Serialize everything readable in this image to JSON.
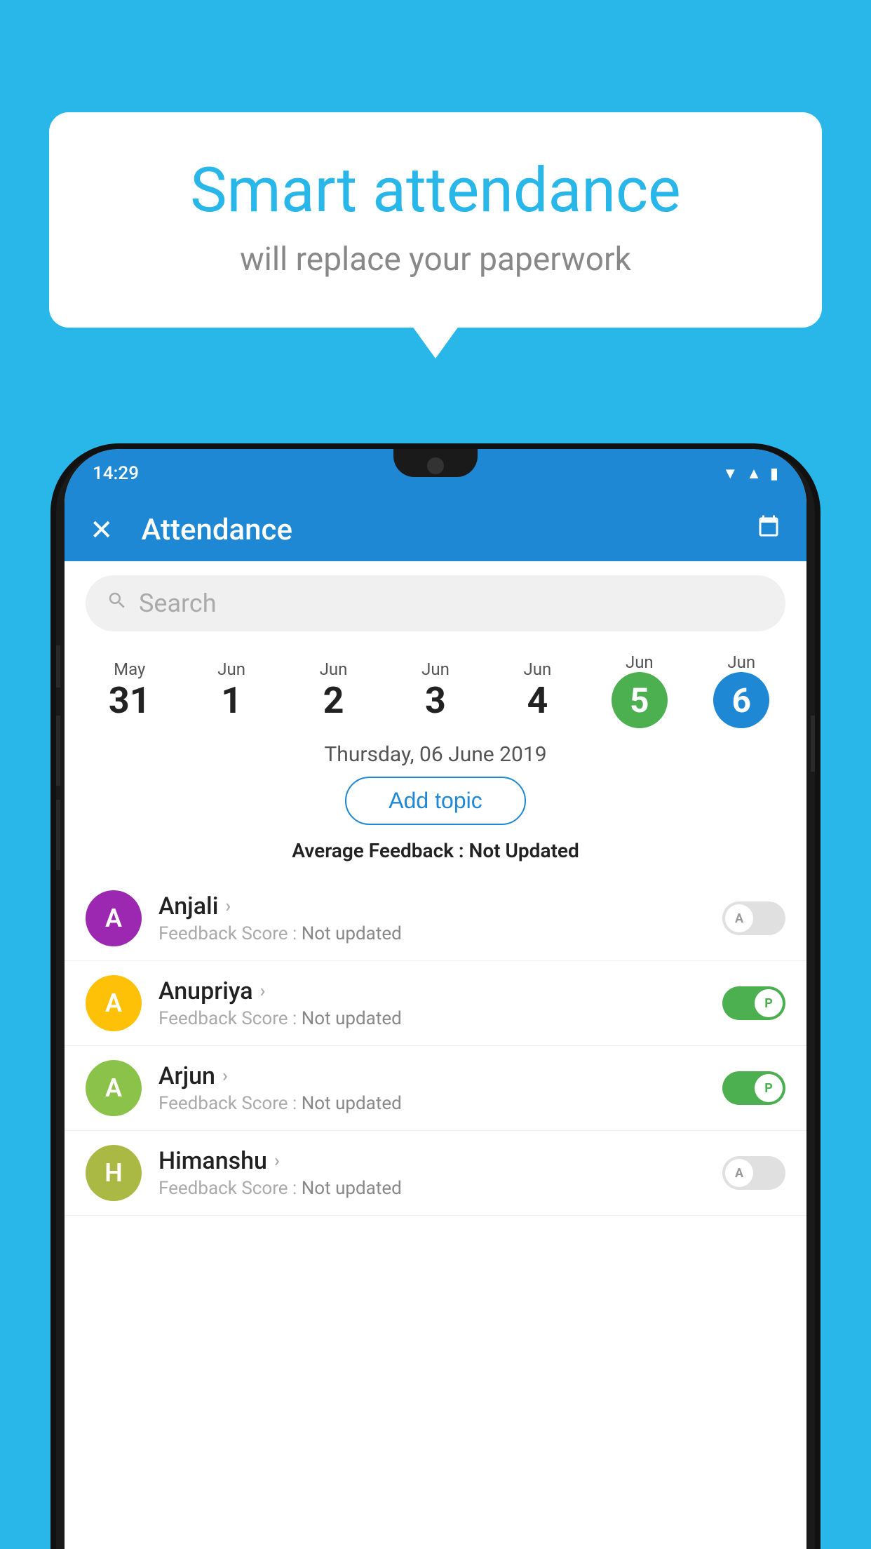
{
  "bubble": {
    "title": "Smart attendance",
    "subtitle": "will replace your paperwork"
  },
  "status_bar": {
    "time": "14:29",
    "icons": [
      "wifi",
      "signal",
      "battery"
    ]
  },
  "app_header": {
    "title": "Attendance",
    "close_label": "×",
    "calendar_icon": "📅"
  },
  "search": {
    "placeholder": "Search"
  },
  "calendar": {
    "days": [
      {
        "month": "May",
        "day": "31",
        "selected": ""
      },
      {
        "month": "Jun",
        "day": "1",
        "selected": ""
      },
      {
        "month": "Jun",
        "day": "2",
        "selected": ""
      },
      {
        "month": "Jun",
        "day": "3",
        "selected": ""
      },
      {
        "month": "Jun",
        "day": "4",
        "selected": ""
      },
      {
        "month": "Jun",
        "day": "5",
        "selected": "green"
      },
      {
        "month": "Jun",
        "day": "6",
        "selected": "blue"
      }
    ]
  },
  "date_header": "Thursday, 06 June 2019",
  "add_topic_label": "Add topic",
  "avg_feedback_label": "Average Feedback :",
  "avg_feedback_value": "Not Updated",
  "students": [
    {
      "name": "Anjali",
      "avatar_letter": "A",
      "avatar_color": "#9c27b0",
      "feedback_label": "Feedback Score :",
      "feedback_value": "Not updated",
      "attendance": "A",
      "toggle": "off"
    },
    {
      "name": "Anupriya",
      "avatar_letter": "A",
      "avatar_color": "#ffc107",
      "feedback_label": "Feedback Score :",
      "feedback_value": "Not updated",
      "attendance": "P",
      "toggle": "on"
    },
    {
      "name": "Arjun",
      "avatar_letter": "A",
      "avatar_color": "#8bc34a",
      "feedback_label": "Feedback Score :",
      "feedback_value": "Not updated",
      "attendance": "P",
      "toggle": "on"
    },
    {
      "name": "Himanshu",
      "avatar_letter": "H",
      "avatar_color": "#aab844",
      "feedback_label": "Feedback Score :",
      "feedback_value": "Not updated",
      "attendance": "A",
      "toggle": "off"
    }
  ]
}
